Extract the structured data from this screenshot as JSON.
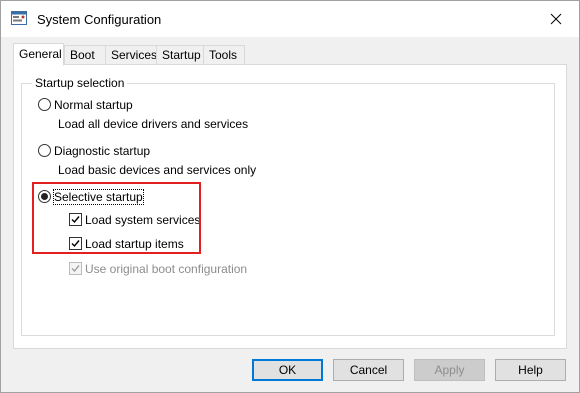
{
  "window": {
    "title": "System Configuration",
    "icon": "system-config-icon",
    "close_icon": "close-icon"
  },
  "tabs": [
    {
      "label": "General",
      "active": true
    },
    {
      "label": "Boot",
      "active": false
    },
    {
      "label": "Services",
      "active": false
    },
    {
      "label": "Startup",
      "active": false
    },
    {
      "label": "Tools",
      "active": false
    }
  ],
  "startup_selection": {
    "legend": "Startup selection",
    "normal": {
      "label": "Normal startup",
      "description": "Load all device drivers and services",
      "selected": false
    },
    "diagnostic": {
      "label": "Diagnostic startup",
      "description": "Load basic devices and services only",
      "selected": false
    },
    "selective": {
      "label": "Selective startup",
      "selected": true,
      "options": {
        "load_system_services": {
          "label": "Load system services",
          "checked": true
        },
        "load_startup_items": {
          "label": "Load startup items",
          "checked": true
        },
        "use_original_boot": {
          "label": "Use original boot configuration",
          "checked": true,
          "disabled": true
        }
      }
    }
  },
  "highlight_color": "#e32020",
  "buttons": {
    "ok": "OK",
    "cancel": "Cancel",
    "apply": "Apply",
    "help": "Help"
  }
}
